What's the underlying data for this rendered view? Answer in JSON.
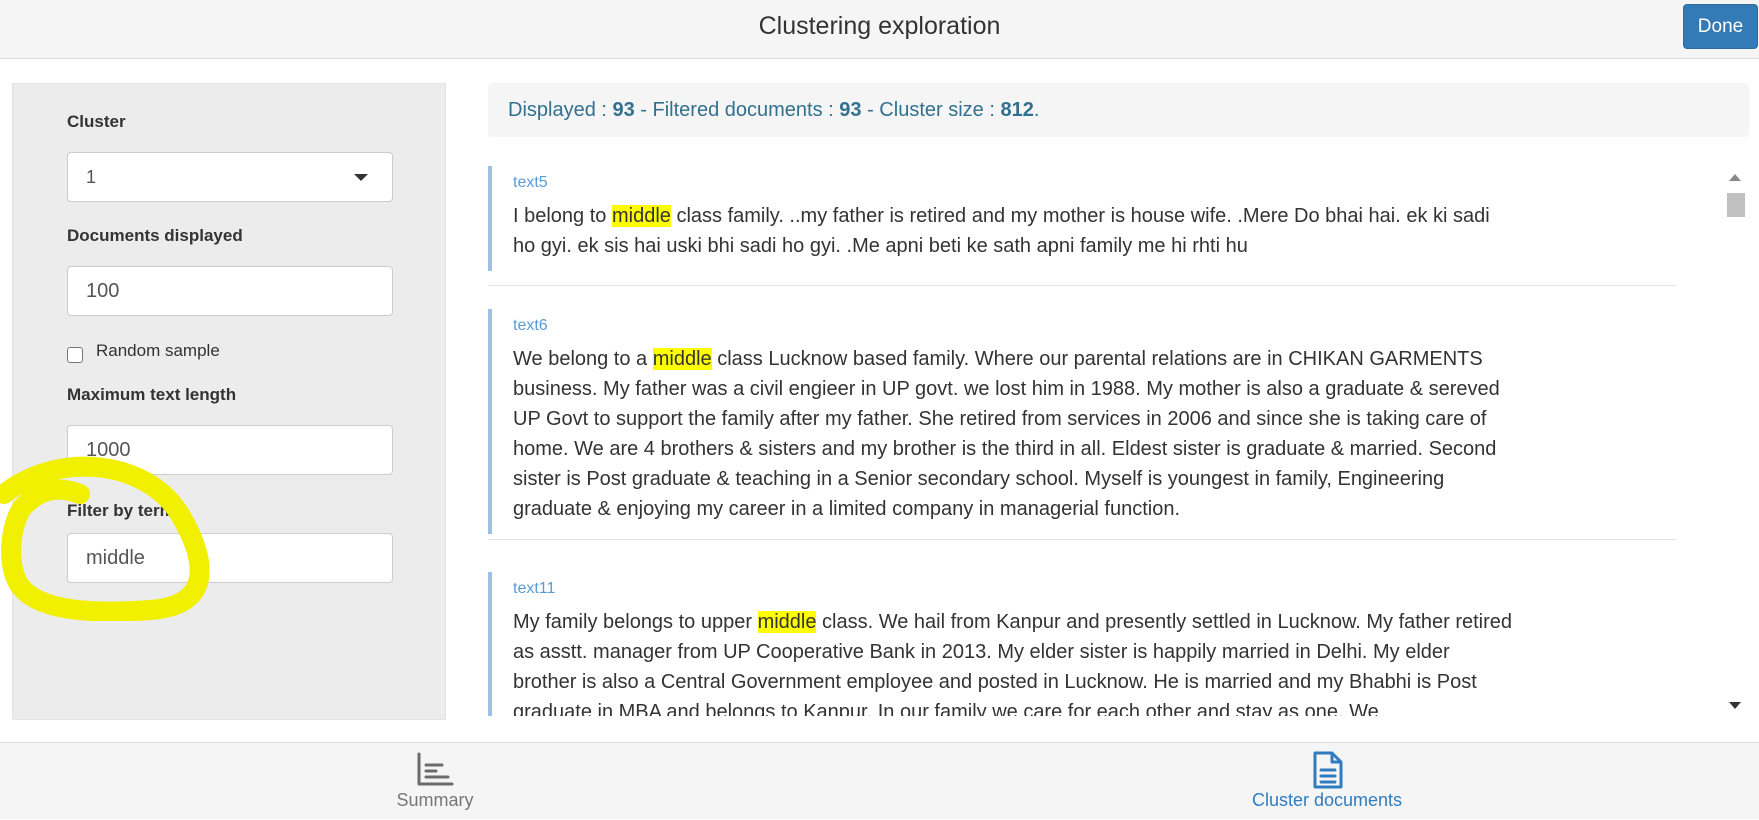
{
  "header": {
    "title": "Clustering exploration",
    "done_label": "Done"
  },
  "sidebar": {
    "cluster_label": "Cluster",
    "cluster_value": "1",
    "docs_label": "Documents displayed",
    "docs_value": "100",
    "random_label": "Random sample",
    "random_checked": false,
    "maxlen_label": "Maximum text length",
    "maxlen_value": "1000",
    "filter_label": "Filter by term",
    "filter_value": "middle"
  },
  "summary": {
    "displayed_label": "Displayed : ",
    "displayed": "93",
    "filtered_label": " - Filtered documents : ",
    "filtered": "93",
    "size_label": " - Cluster size : ",
    "size": "812",
    "end": "."
  },
  "documents": [
    {
      "id": "text5",
      "before": "I belong to ",
      "term": "middle",
      "after": " class family. ..my father is retired and my mother is house wife. .Mere Do bhai hai. ek ki sadi ho gyi. ek sis hai uski bhi sadi ho gyi. .Me apni beti ke sath apni family me hi rhti hu"
    },
    {
      "id": "text6",
      "before": "We belong to a ",
      "term": "middle",
      "after": " class Lucknow based family. Where our parental relations are in CHIKAN GARMENTS business. My father was a civil engieer in UP govt. we lost him in 1988. My mother is also a graduate & sereved UP Govt to support the family after my father. She retired from services in 2006 and since she is taking care of home. We are 4 brothers & sisters and my brother is the third in all. Eldest sister is graduate & married. Second sister is Post graduate & teaching in a Senior secondary school. Myself is youngest in family, Engineering graduate & enjoying my career in a limited company in managerial function."
    },
    {
      "id": "text11",
      "before": "My family belongs to upper ",
      "term": "middle",
      "after": " class. We hail from Kanpur and presently settled in Lucknow. My father retired as asstt. manager from UP Cooperative Bank in 2013. My elder sister is happily married in Delhi. My elder brother is also a Central Government employee and posted in Lucknow. He is married and my Bhabhi is Post graduate in MBA and belongs to Kanpur. In our family we care for each other and stay as one. We"
    }
  ],
  "tabs": {
    "summary_label": "Summary",
    "cluster_docs_label": "Cluster documents"
  },
  "colors": {
    "accent": "#337ab7",
    "info_text": "#31708f",
    "highlight": "#ffff00",
    "active_tab": "#2f7cc1",
    "annotation": "#f0f000"
  },
  "icons": {
    "summary_tab": "bar-chart-icon",
    "cluster_docs_tab": "document-icon",
    "cluster_select": "chevron-down-icon"
  }
}
